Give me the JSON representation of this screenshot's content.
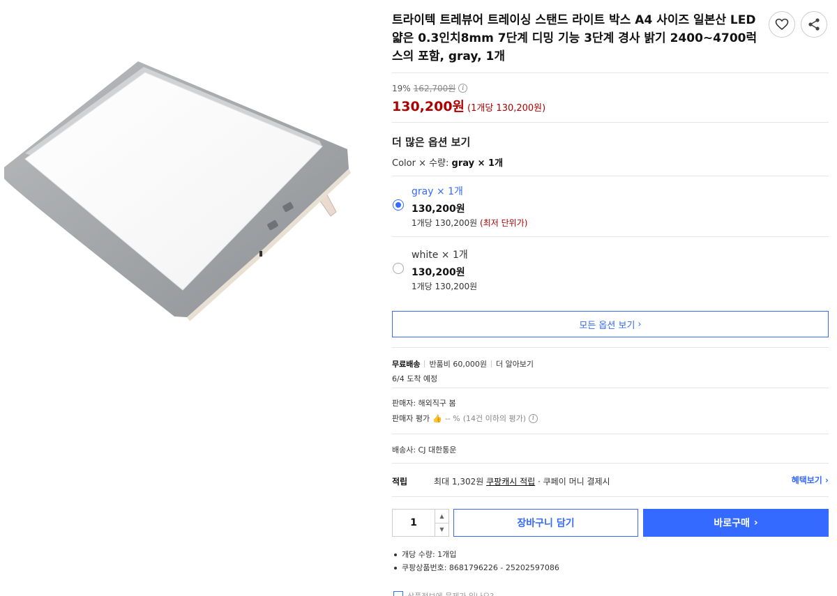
{
  "product": {
    "title": "트라이텍 트레뷰어 트레이싱 스탠드 라이트 박스 A4 사이즈 일본산 LED 얇은 0.3인치8mm 7단계 디밍 기능 3단계 경사 밝기 2400~4700럭스의 포함, gray, 1개",
    "image_icon": "light-box-image"
  },
  "actions": {
    "favorite_icon": "heart-icon",
    "share_icon": "share-icon"
  },
  "price": {
    "discount_rate": "19%",
    "original_price": "162,700원",
    "sale_price": "130,200원",
    "unit_price": "(1개당 130,200원)",
    "sale_color": "#ae0000"
  },
  "options": {
    "title": "더 많은 옵션 보기",
    "summary_prefix": "Color × 수량:",
    "summary_value": "gray × 1개",
    "items": [
      {
        "name": "gray × 1개",
        "price": "130,200원",
        "unit": "1개당 130,200원",
        "badge": "(최저 단위가)",
        "selected": true
      },
      {
        "name": "white × 1개",
        "price": "130,200원",
        "unit": "1개당 130,200원",
        "badge": "",
        "selected": false
      }
    ],
    "all_options_label": "모든 옵션 보기",
    "accent_color": "#346aff"
  },
  "shipping": {
    "free_label": "무료배송",
    "return_fee": "반품비 60,000원",
    "learn_more": "더 알아보기",
    "arrival": "6/4 도착 예정"
  },
  "seller": {
    "name_line": "판매자: 해외직구 봄",
    "rating_label": "판매자 평가",
    "rating_value": "-- %",
    "rating_note": "(14건 이하의 평가)"
  },
  "carrier": "배송사: CJ 대한통운",
  "reward": {
    "label": "적립",
    "text_prefix": "최대 1,302원",
    "text_link": "쿠팡캐시 적립",
    "text_suffix": "· 쿠페이 머니 결제시",
    "benefits_link": "혜택보기"
  },
  "purchase": {
    "quantity": "1",
    "cart_label": "장바구니 담기",
    "buy_label": "바로구매"
  },
  "details": [
    "개당 수량: 1개입",
    "쿠팡상품번호: 8681796226 - 25202597086"
  ],
  "cut_off_text": "상품정보에 문제가 있나요?"
}
